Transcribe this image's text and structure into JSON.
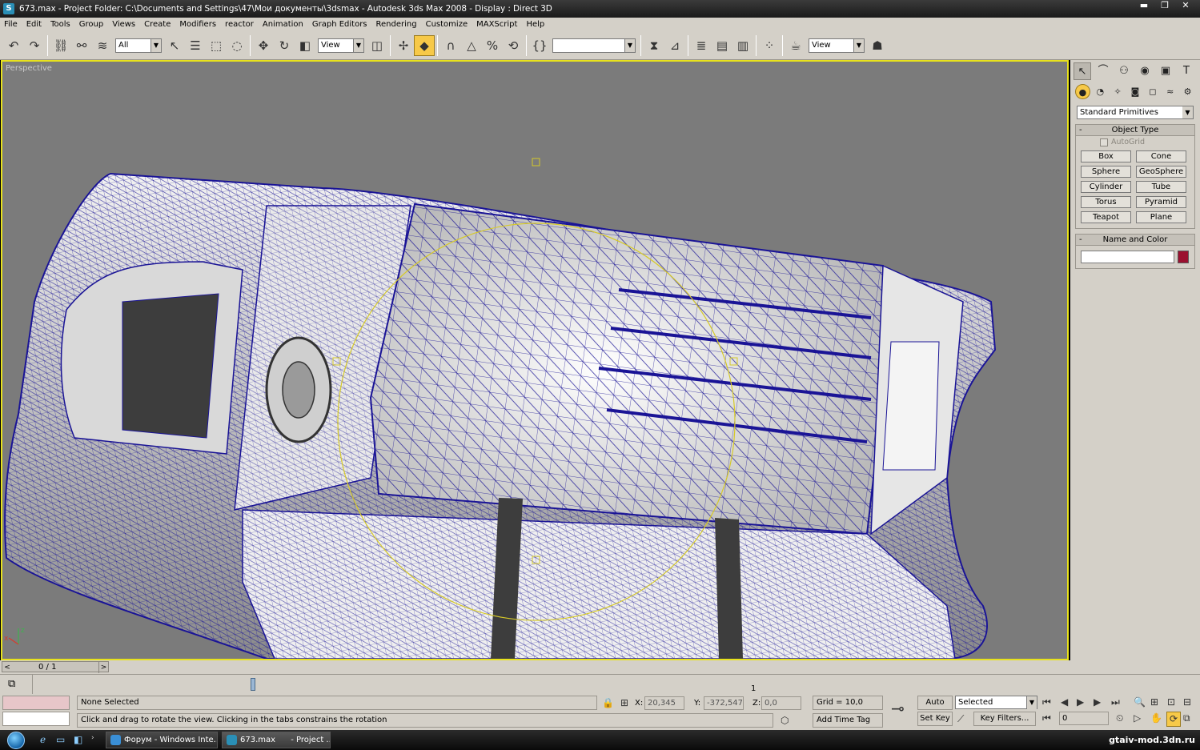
{
  "window": {
    "title": "673.max      - Project Folder: C:\\Documents and Settings\\47\\Мои документы\\3dsmax      - Autodesk 3ds Max 2008      - Display : Direct 3D",
    "controls": [
      "▬",
      "❐",
      "✕"
    ]
  },
  "menu": [
    "File",
    "Edit",
    "Tools",
    "Group",
    "Views",
    "Create",
    "Modifiers",
    "reactor",
    "Animation",
    "Graph Editors",
    "Rendering",
    "Customize",
    "MAXScript",
    "Help"
  ],
  "toolbar": {
    "selection_filter": "All",
    "ref_coord": "View",
    "named_selection": "",
    "render_view": "View"
  },
  "viewport": {
    "label": "Perspective",
    "axis_x": "x",
    "axis_z": "z",
    "wire_color": "#1a1496"
  },
  "command_panel": {
    "category_dropdown": "Standard Primitives",
    "object_type": {
      "title": "Object Type",
      "autogrid": "AutoGrid",
      "buttons": [
        "Box",
        "Cone",
        "Sphere",
        "GeoSphere",
        "Cylinder",
        "Tube",
        "Torus",
        "Pyramid",
        "Teapot",
        "Plane"
      ]
    },
    "name_and_color": {
      "title": "Name and Color",
      "name_value": "",
      "color": "#9b1130"
    }
  },
  "time": {
    "frame_label": "0 / 1",
    "track_tick": "1"
  },
  "status": {
    "selection": "None Selected",
    "prompt": "Click and drag to rotate the view.  Clicking in the tabs constrains the rotation",
    "x_label": "X:",
    "x_value": "20,345",
    "y_label": "Y:",
    "y_value": "-372,547",
    "z_label": "Z:",
    "z_value": "0,0",
    "grid": "Grid = 10,0",
    "add_time_tag": "Add Time Tag",
    "auto_key": "Auto Key",
    "set_key": "Set Key",
    "key_mode": "Selected",
    "key_filters": "Key Filters...",
    "current_frame": "0"
  },
  "taskbar": {
    "tasks": [
      "Форум - Windows Inte...",
      "673.max",
      "- Project ..."
    ],
    "watermark": "gtaiv-mod.3dn.ru"
  }
}
